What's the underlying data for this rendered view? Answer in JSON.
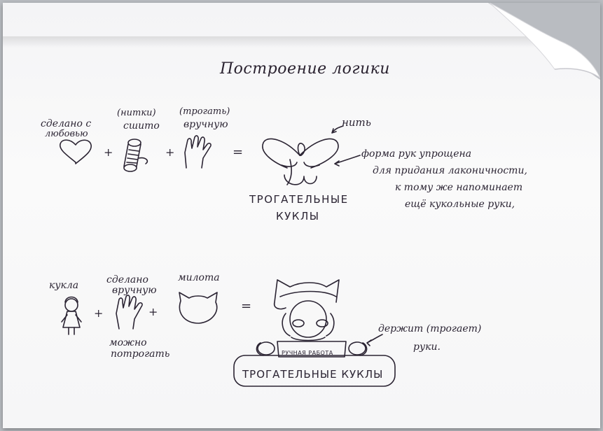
{
  "title": "Построение логики",
  "row1": {
    "label_love_1": "сделано с",
    "label_love_2": "любовью",
    "label_threads": "(нитки)",
    "label_sewn": "сшито",
    "label_touch": "(трогать)",
    "label_hand": "вручную",
    "label_thread": "нить",
    "logo_line1": "ТРОГАТЕЛЬНЫЕ",
    "logo_line2": "КУКЛЫ",
    "note_lines": [
      "форма рук упрощена",
      "для придания лаконичности,",
      "к тому же напоминает",
      "ещё кукольные руки,"
    ]
  },
  "row2": {
    "label_doll": "кукла",
    "label_handmade_1": "сделано",
    "label_handmade_2": "вручную",
    "label_cute": "милота",
    "label_touchable_1": "можно",
    "label_touchable_2": "потрогать",
    "sign_small": "РУЧНАЯ РАБОТА",
    "sign_big": "ТРОГАТЕЛЬНЫЕ КУКЛЫ",
    "note_line1": "держит (трогает)",
    "note_line2": "руки."
  },
  "symbols": {
    "plus": "+",
    "equals": "="
  }
}
